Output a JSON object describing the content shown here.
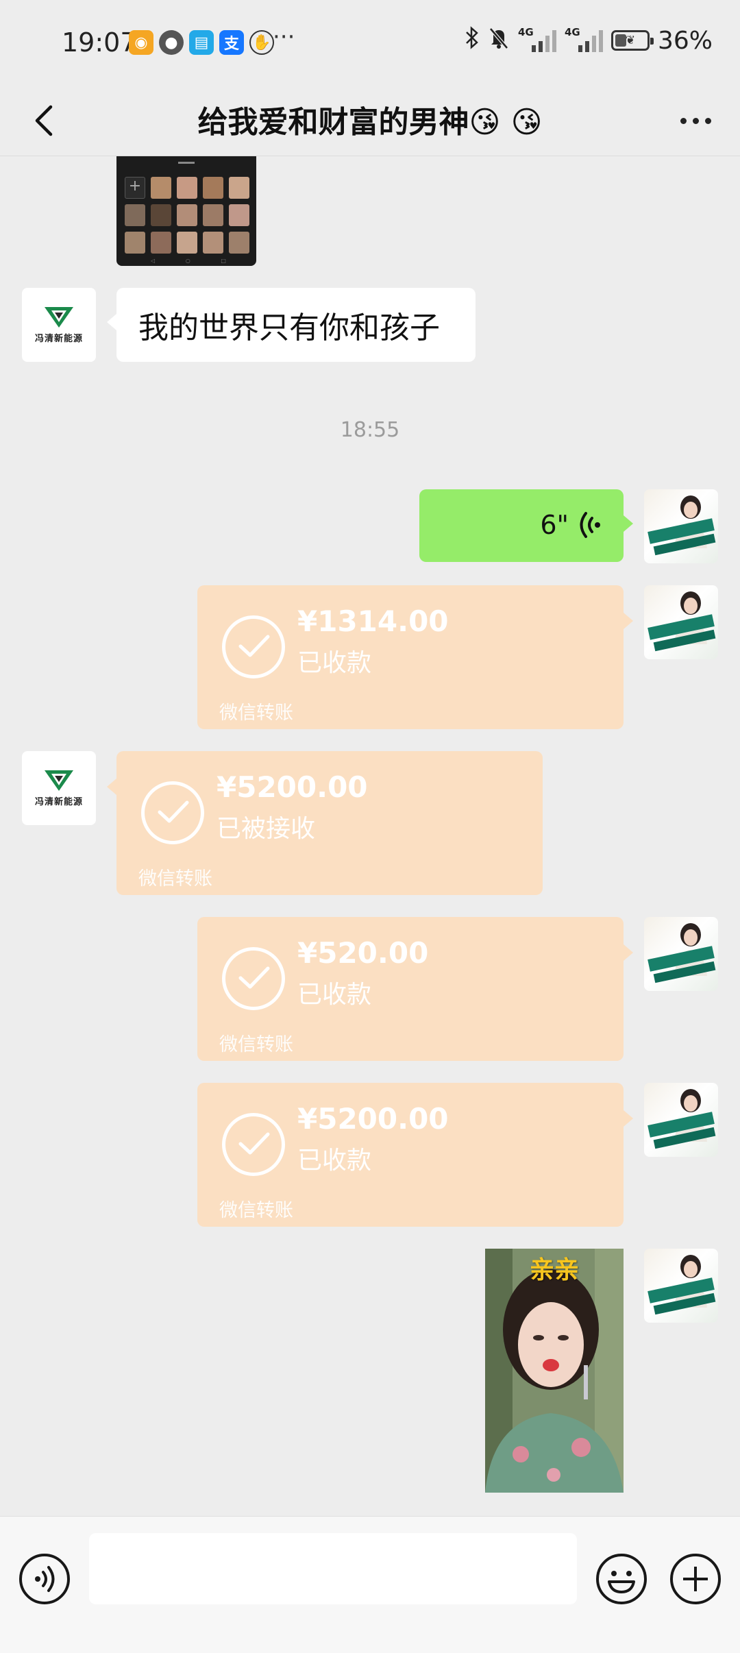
{
  "status_bar": {
    "time": "19:07",
    "overflow": "···",
    "network_1": "4G",
    "network_2": "4G",
    "battery_percent": "36%",
    "battery_level": 0.36,
    "icons": [
      "weibo-icon",
      "chat-bubble-icon",
      "book-icon",
      "alipay-icon",
      "hand-icon",
      "bluetooth-icon",
      "mute-bell-icon"
    ]
  },
  "nav": {
    "title": "给我爱和财富的男神😘 😘"
  },
  "messages": {
    "text_1": "我的世界只有你和孩子",
    "time_divider": "18:55",
    "voice_duration": "6\"",
    "transfer_1": {
      "amount": "¥1314.00",
      "status": "已收款",
      "source": "微信转账"
    },
    "transfer_2": {
      "amount": "¥5200.00",
      "status": "已被接收",
      "source": "微信转账"
    },
    "transfer_3": {
      "amount": "¥520.00",
      "status": "已收款",
      "source": "微信转账"
    },
    "transfer_4": {
      "amount": "¥5200.00",
      "status": "已收款",
      "source": "微信转账"
    },
    "photo_caption": "亲亲"
  },
  "avatars": {
    "contact_logo_text": "冯清新能源"
  },
  "colors": {
    "background": "#ededed",
    "voice_bubble": "#95ec69",
    "transfer_card": "#fbdfc2",
    "logo_green": "#1b8a4b"
  }
}
